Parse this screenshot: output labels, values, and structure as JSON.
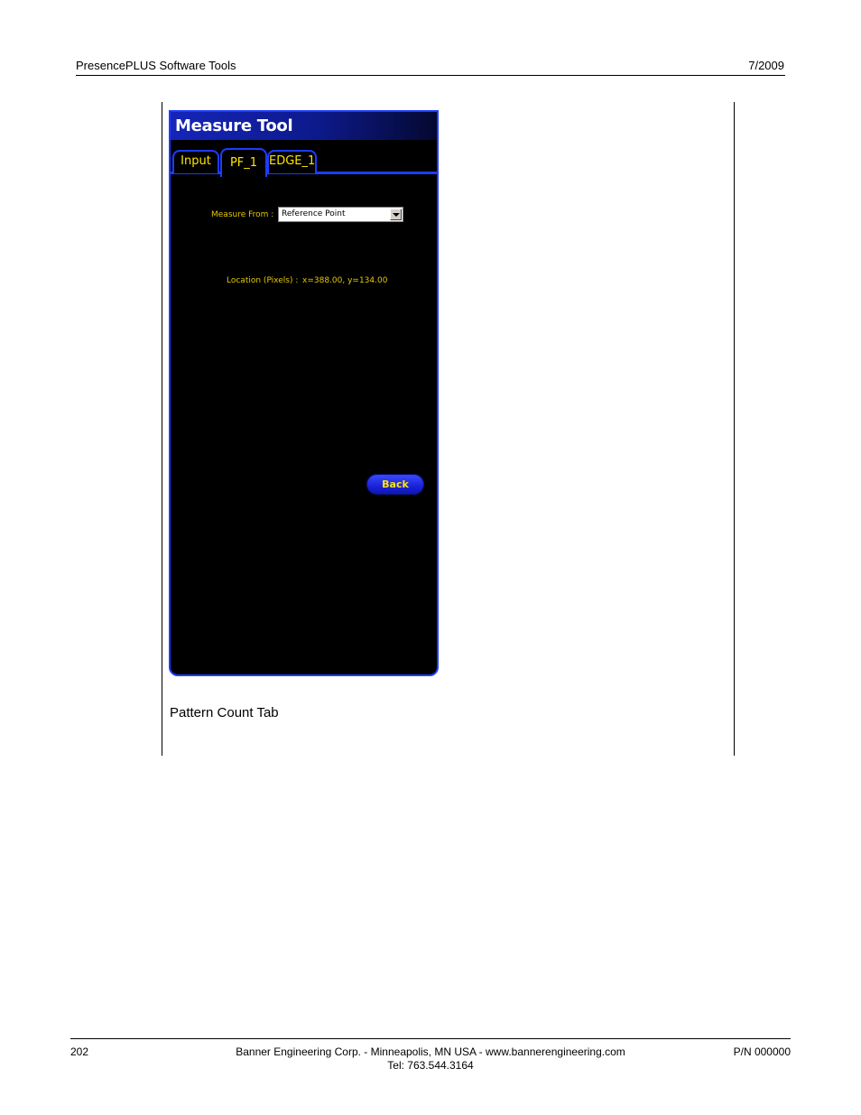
{
  "header": {
    "doc_title": "PresencePLUS Software Tools",
    "date": "7/2009"
  },
  "screen": {
    "window_title": "Measure Tool",
    "tabs": [
      {
        "label": "Input"
      },
      {
        "label": "PF_1"
      },
      {
        "label": "EDGE_1"
      }
    ],
    "active_tab": "PF_1",
    "measure_from_label": "Measure From :",
    "measure_from_value": "Reference Point",
    "location_label": "Location (Pixels) :",
    "location_value": "x=388.00, y=134.00",
    "back_label": "Back",
    "colors": {
      "accent": "#1e3cff",
      "label": "#e6c800",
      "background": "#000000"
    }
  },
  "caption": "Pattern Count Tab",
  "footer": {
    "page_number": "202",
    "company_line": "Banner Engineering Corp. - Minneapolis, MN USA - www.bannerengineering.com",
    "tel": "Tel: 763.544.3164",
    "part_number": "P/N 000000"
  }
}
